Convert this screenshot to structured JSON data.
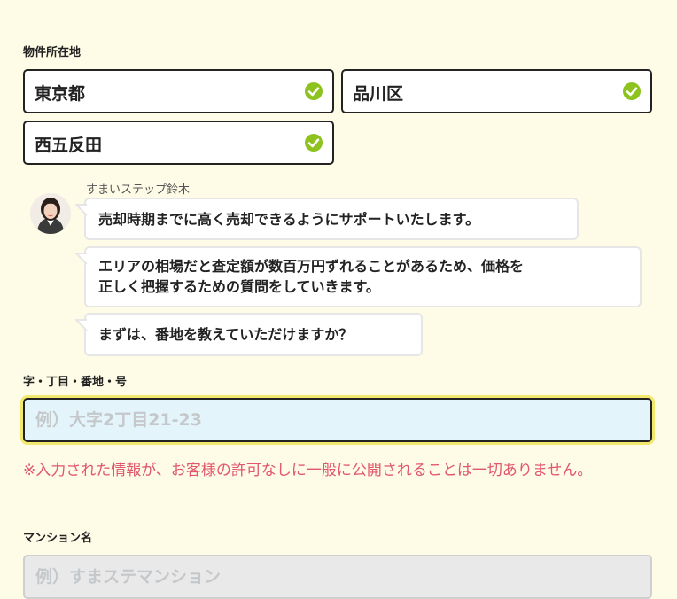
{
  "location": {
    "label": "物件所在地",
    "prefecture": "東京都",
    "city": "品川区",
    "town": "西五反田",
    "check_color": "#8dc21f"
  },
  "chat": {
    "staff_name": "すまいステップ鈴木",
    "messages": [
      "売却時期までに高く売却できるようにサポートいたします。",
      "エリアの相場だと査定額が数百万円ずれることがあるため、価格を",
      "正しく把握するための質問をしていきます。",
      "まずは、番地を教えていただけますか？"
    ]
  },
  "address": {
    "label": "字・丁目・番地・号",
    "placeholder": "例）大字2丁目21-23",
    "value": ""
  },
  "notice": "※入力された情報が、お客様の許可なしに一般に公開されることは一切ありません。",
  "mansion": {
    "label": "マンション名",
    "placeholder": "例）すまステマンション",
    "value": ""
  }
}
